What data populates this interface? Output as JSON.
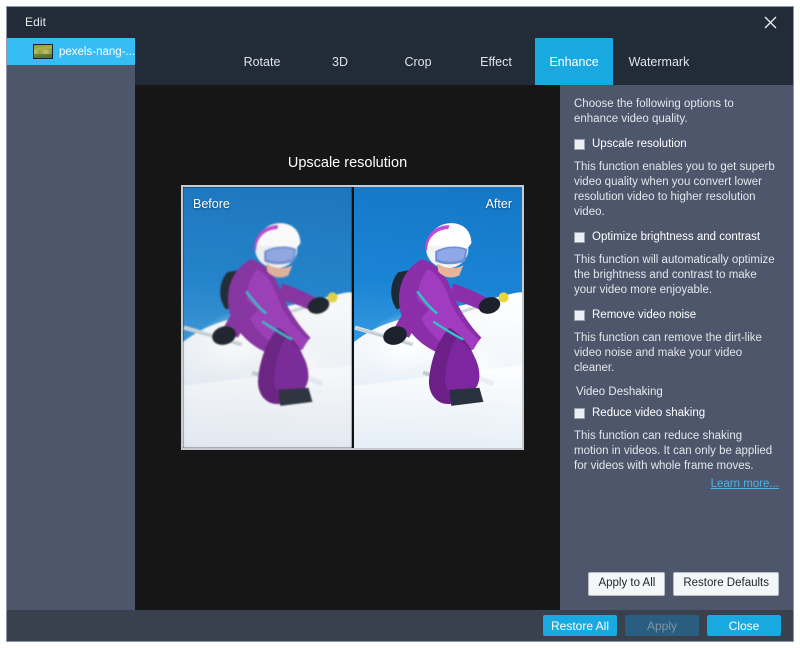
{
  "window": {
    "title": "Edit",
    "close_icon": "close-icon"
  },
  "sidebar": {
    "files": [
      {
        "name": "pexels-nang-...",
        "thumb_icon": "video-thumbnail-icon",
        "selected": true
      }
    ]
  },
  "tabs": [
    {
      "label": "Rotate",
      "active": false
    },
    {
      "label": "3D",
      "active": false
    },
    {
      "label": "Crop",
      "active": false
    },
    {
      "label": "Effect",
      "active": false
    },
    {
      "label": "Enhance",
      "active": true
    },
    {
      "label": "Watermark",
      "active": false
    }
  ],
  "preview": {
    "title": "Upscale resolution",
    "before_label": "Before",
    "after_label": "After"
  },
  "options": {
    "intro": "Choose the following options to enhance video quality.",
    "items": [
      {
        "label": "Upscale resolution",
        "checked": false,
        "description": "This function enables you to get superb video quality when you convert lower resolution video to higher resolution video."
      },
      {
        "label": "Optimize brightness and contrast",
        "checked": false,
        "description": "This function will automatically optimize the brightness and contrast to make your video more enjoyable."
      },
      {
        "label": "Remove video noise",
        "checked": false,
        "description": "This function can remove the dirt-like video noise and make your video cleaner."
      }
    ],
    "group": {
      "title": "Video Deshaking",
      "item": {
        "label": "Reduce video shaking",
        "checked": false,
        "description": "This function can reduce shaking motion in videos. It can only be applied for videos with whole frame moves."
      }
    },
    "learn_more": "Learn more...",
    "apply_to_all": "Apply to All",
    "restore_defaults": "Restore Defaults"
  },
  "footer": {
    "restore_all": "Restore All",
    "apply": "Apply",
    "apply_disabled": true,
    "close": "Close"
  },
  "colors": {
    "accent": "#17a9e0",
    "panel": "#4d566b",
    "titlebar": "#222b38",
    "stage": "#161616",
    "footer": "#39414f",
    "link": "#4fb3e8"
  }
}
